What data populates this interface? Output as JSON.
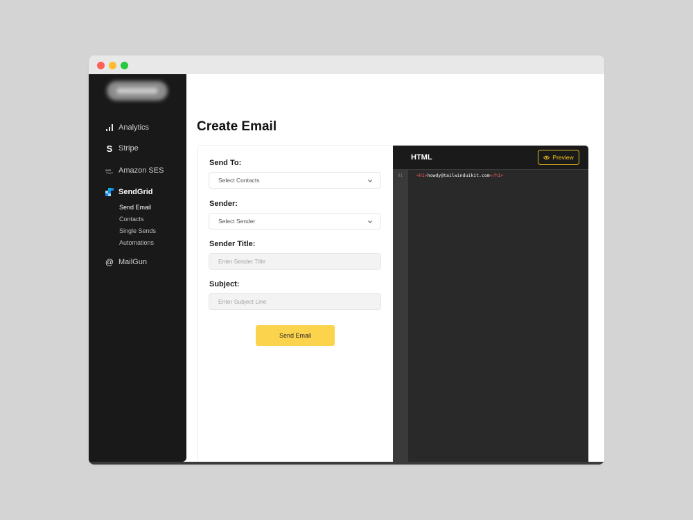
{
  "sidebar": {
    "nav": [
      {
        "label": "Analytics",
        "icon": "bar-chart-icon"
      },
      {
        "label": "Stripe",
        "icon": "stripe-icon"
      },
      {
        "label": "Amazon SES",
        "icon": "aws-icon"
      },
      {
        "label": "SendGrid",
        "icon": "sendgrid-icon"
      },
      {
        "label": "MailGun",
        "icon": "at-sign-icon"
      }
    ],
    "sendgrid_sub": [
      "Send Email",
      "Contacts",
      "Single Sends",
      "Automations"
    ]
  },
  "main": {
    "title": "Create Email",
    "form": {
      "send_to_label": "Send To:",
      "send_to_value": "Select Contacts",
      "sender_label": "Sender:",
      "sender_value": "Select Sender",
      "sender_title_label": "Sender Title:",
      "sender_title_placeholder": "Enter Sender Title",
      "subject_label": "Subject:",
      "subject_placeholder": "Enter Subject Line",
      "submit_label": "Send Email"
    },
    "editor": {
      "title": "HTML",
      "preview_label": "Preview",
      "line_number": "01",
      "code_open_tag": "<h1>",
      "code_text": "howdy@tailwinduikit.com",
      "code_close_tag": "</h1>"
    }
  },
  "colors": {
    "accent": "#fcd34d",
    "sidebar_bg": "#191919",
    "editor_bg": "#292929",
    "tag_color": "#ff5c5c"
  }
}
